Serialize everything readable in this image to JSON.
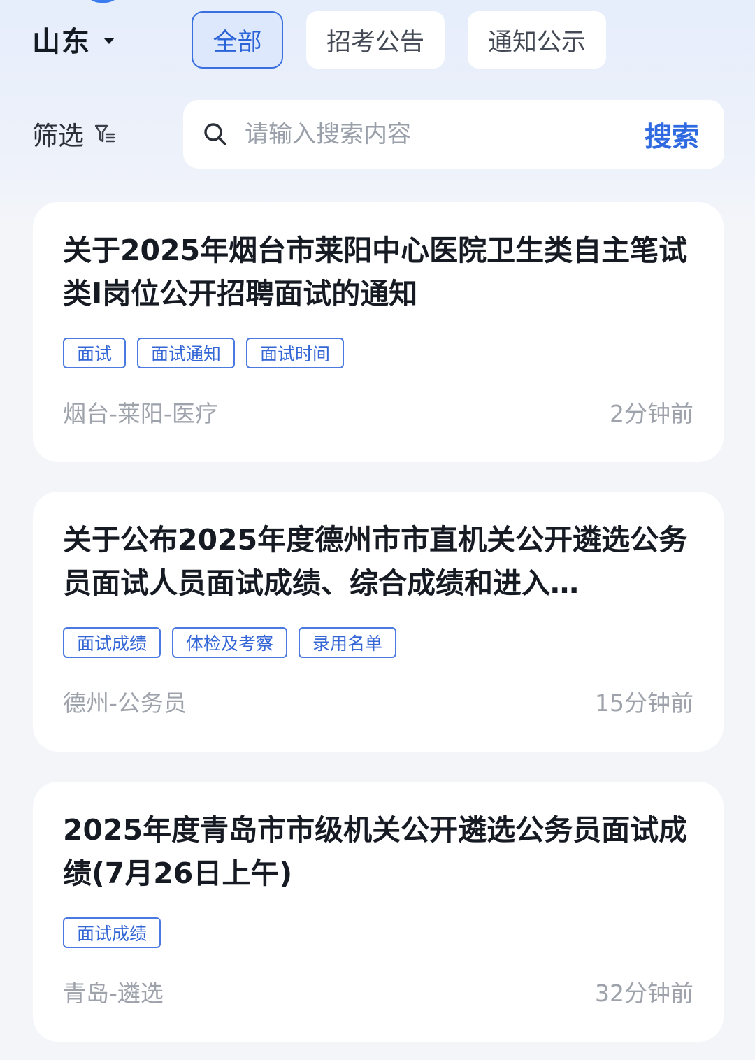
{
  "header": {
    "region": "山东",
    "tabs": [
      {
        "label": "全部",
        "active": true
      },
      {
        "label": "招考公告",
        "active": false
      },
      {
        "label": "通知公示",
        "active": false
      }
    ]
  },
  "filter": {
    "label": "筛选"
  },
  "search": {
    "placeholder": "请输入搜索内容",
    "button_label": "搜索"
  },
  "cards": [
    {
      "title": "关于2025年烟台市莱阳中心医院卫生类自主笔试类I岗位公开招聘面试的通知",
      "tags": [
        "面试",
        "面试通知",
        "面试时间"
      ],
      "meta": "烟台-莱阳-医疗",
      "time": "2分钟前"
    },
    {
      "title": "关于公布2025年度德州市市直机关公开遴选公务员面试人员面试成绩、综合成绩和进入…",
      "tags": [
        "面试成绩",
        "体检及考察",
        "录用名单"
      ],
      "meta": "德州-公务员",
      "time": "15分钟前"
    },
    {
      "title": "2025年度青岛市市级机关公开遴选公务员面试成绩(7月26日上午)",
      "tags": [
        "面试成绩"
      ],
      "meta": "青岛-遴选",
      "time": "32分钟前"
    }
  ],
  "colors": {
    "accent": "#2f6ae0",
    "tab_active_bg": "#dde8fc",
    "muted_text": "#9ea3ab"
  }
}
